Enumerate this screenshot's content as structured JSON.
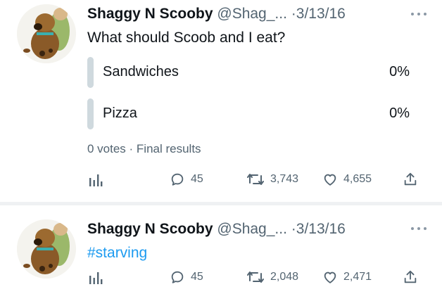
{
  "tweets": [
    {
      "author_name": "Shaggy N Scooby",
      "handle": "@Shag_...",
      "separator": "·",
      "date": "3/13/16",
      "text": "What should Scoob and I eat?",
      "poll": {
        "options": [
          {
            "label": "Sandwiches",
            "percent": "0%"
          },
          {
            "label": "Pizza",
            "percent": "0%"
          }
        ],
        "meta": "0 votes · Final results"
      },
      "actions": {
        "analytics_icon": "bar-chart-icon",
        "replies": "45",
        "retweets": "3,743",
        "likes": "4,655",
        "share_icon": "share-icon"
      }
    },
    {
      "author_name": "Shaggy N Scooby",
      "handle": "@Shag_...",
      "separator": "·",
      "date": "3/13/16",
      "text": "#starving",
      "actions": {
        "analytics_icon": "bar-chart-icon",
        "replies": "45",
        "retweets": "2,048",
        "likes": "2,471",
        "share_icon": "share-icon"
      }
    }
  ],
  "colors": {
    "text_primary": "#0f1419",
    "text_secondary": "#536471",
    "hashtag": "#1d9bf0",
    "poll_bar": "#cfd9de"
  }
}
